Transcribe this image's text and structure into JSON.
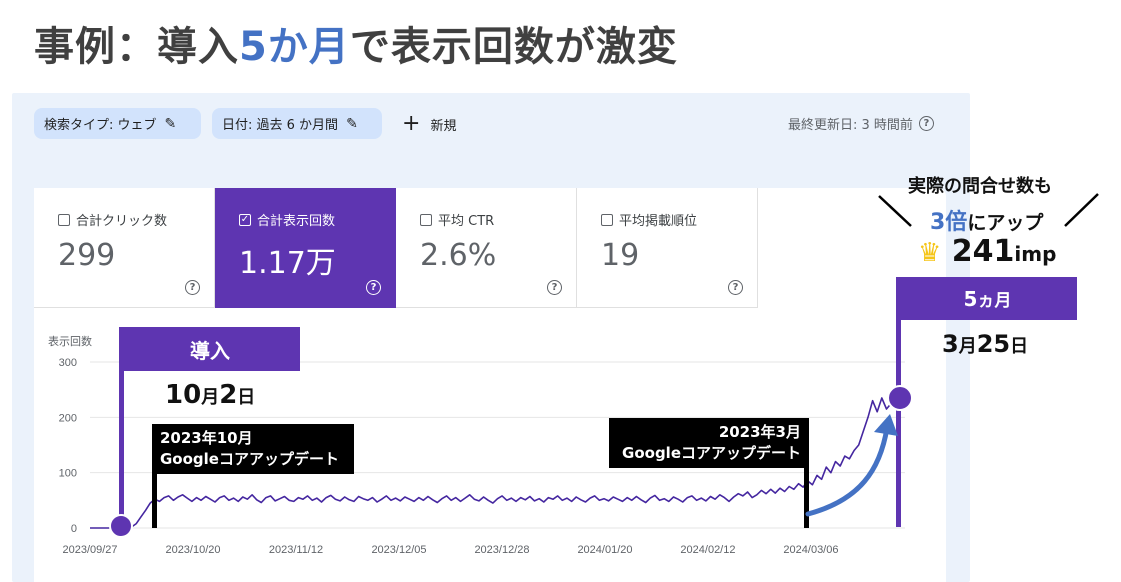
{
  "slide": {
    "title_pre": "事例：導入",
    "title_highlight": "5か月",
    "title_post": "で表示回数が激変"
  },
  "filters": {
    "chip1": "検索タイプ: ウェブ",
    "chip2": "日付: 過去 6 か月間",
    "new_label": "新規",
    "new_icon": "+",
    "updated": "最終更新日: 3 時間前",
    "help_icon": "?"
  },
  "metrics": [
    {
      "label": "合計クリック数",
      "value": "299",
      "checked": false
    },
    {
      "label": "合計表示回数",
      "value": "1.17万",
      "checked": true
    },
    {
      "label": "平均 CTR",
      "value": "2.6%",
      "checked": false
    },
    {
      "label": "平均掲載順位",
      "value": "19",
      "checked": false
    }
  ],
  "checkbox_icon": "✓",
  "annotations": {
    "intro_label": "導入",
    "intro_date_a": "10",
    "intro_date_b": "月",
    "intro_date_c": "2",
    "intro_date_d": "日",
    "update1_line1": "2023年10月",
    "update1_line2": "Googleコアアップデート",
    "update2_line1": "2023年3月",
    "update2_line2": "Googleコアアップデート",
    "five_months_a": "5",
    "five_months_b": "ヵ月",
    "end_date_a": "3",
    "end_date_b": "月",
    "end_date_c": "25",
    "end_date_d": "日",
    "inquiry_line": "実際の問合せ数も",
    "triple_a": "3倍",
    "triple_b": "にアップ",
    "crown_icon": "♛",
    "imp_value": "241",
    "imp_unit": "imp"
  },
  "colors": {
    "line": "#4527a0",
    "accent_purple": "#5e35b1",
    "arrow": "#4472c4",
    "title_highlight": "#4472c4"
  },
  "chart_data": {
    "type": "line",
    "ylabel": "表示回数",
    "yticks": [
      0,
      100,
      200,
      300
    ],
    "ylim": [
      0,
      300
    ],
    "xticks": [
      "2023/09/27",
      "2023/10/20",
      "2023/11/12",
      "2023/12/05",
      "2023/12/28",
      "2024/01/20",
      "2024/02/12",
      "2024/03/06"
    ],
    "x_start": "2023/09/27",
    "x_end": "2024/03/27",
    "grid": true,
    "series": [
      {
        "values": [
          0,
          0,
          0,
          0,
          0,
          0,
          0,
          0,
          0,
          2,
          8,
          20,
          32,
          45,
          52,
          48,
          55,
          58,
          50,
          56,
          60,
          54,
          48,
          55,
          50,
          57,
          52,
          47,
          55,
          58,
          50,
          54,
          48,
          56,
          52,
          60,
          51,
          46,
          55,
          58,
          49,
          53,
          57,
          50,
          48,
          55,
          52,
          58,
          50,
          54,
          47,
          55,
          59,
          52,
          49,
          56,
          51,
          48,
          57,
          53,
          50,
          55,
          47,
          52,
          58,
          50,
          54,
          49,
          56,
          52,
          48,
          55,
          50,
          57,
          51,
          46,
          53,
          58,
          50,
          55,
          48,
          54,
          60,
          52,
          49,
          56,
          50,
          45,
          53,
          58,
          50,
          54,
          48,
          55,
          51,
          57,
          49,
          53,
          47,
          55,
          52,
          58,
          50,
          54,
          48,
          56,
          51,
          47,
          54,
          58,
          50,
          53,
          49,
          56,
          52,
          48,
          55,
          50,
          57,
          51,
          46,
          54,
          59,
          50,
          53,
          48,
          56,
          52,
          47,
          55,
          58,
          50,
          54,
          49,
          57,
          52,
          60,
          55,
          48,
          56,
          62,
          58,
          65,
          55,
          60,
          68,
          62,
          70,
          63,
          72,
          66,
          75,
          70,
          80,
          74,
          85,
          78,
          95,
          88,
          110,
          100,
          120,
          112,
          130,
          125,
          140,
          150,
          175,
          200,
          230,
          210,
          235,
          215,
          225,
          220,
          230,
          241
        ]
      }
    ]
  }
}
